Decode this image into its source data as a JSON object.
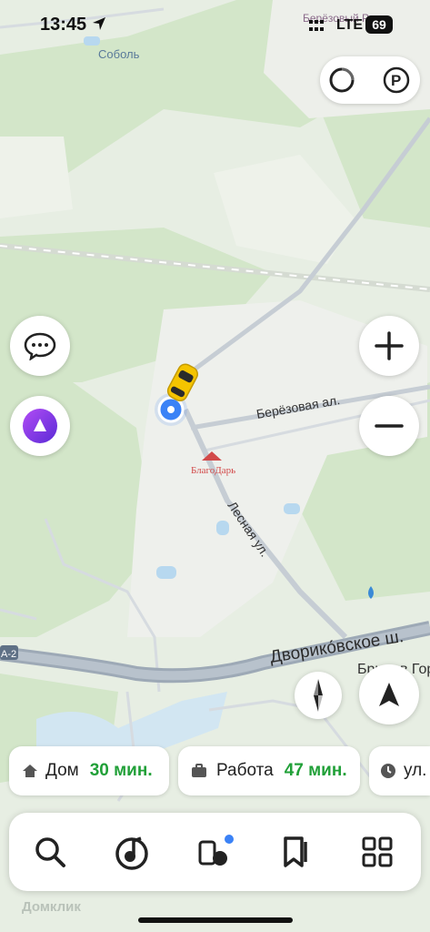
{
  "status_bar": {
    "time": "13:45",
    "network": "LTE",
    "battery": "69"
  },
  "map": {
    "village_top": "Соболь",
    "village_top_right": "Берёзовый Р...",
    "road_1": "Берёзовая ал.",
    "road_2": "Лесная ул.",
    "highway": "Дворико́вское ш.",
    "highway_code": "А-2",
    "village_right": "Брыков Гор",
    "watermark": "Домклик",
    "logo": "БлагоДарь"
  },
  "shortcuts": [
    {
      "label": "Дом",
      "eta": "30 мин."
    },
    {
      "label": "Работа",
      "eta": "47 мин."
    },
    {
      "label": "ул."
    }
  ],
  "icons": {
    "top_pill": [
      "traffic-icon",
      "parking-icon"
    ],
    "left": [
      "chat-icon",
      "alice-icon"
    ],
    "right": [
      "zoom-in-icon",
      "zoom-out-icon",
      "compass-icon",
      "navigation-arrow-icon"
    ],
    "bottom_bar": [
      "search-icon",
      "music-icon",
      "transport-icon",
      "bookmarks-icon",
      "services-icon"
    ]
  },
  "colors": {
    "accent": "#21a038",
    "location": "#3b82f6",
    "alice": "#8f3cf5"
  }
}
